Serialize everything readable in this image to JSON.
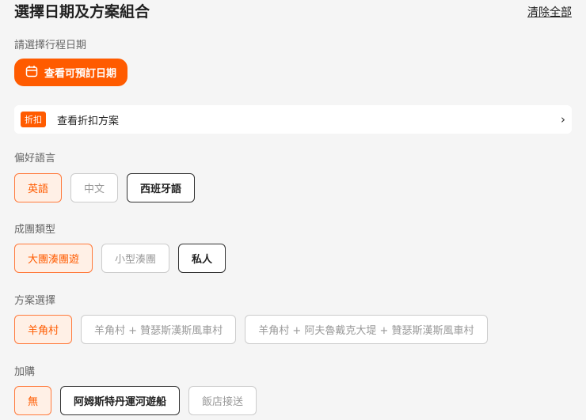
{
  "header": {
    "title": "選擇日期及方案組合",
    "clear_all": "清除全部"
  },
  "date": {
    "label": "請選擇行程日期",
    "button": "查看可預訂日期"
  },
  "discount": {
    "badge": "折扣",
    "text": "查看折扣方案"
  },
  "sections": [
    {
      "label": "偏好語言",
      "options": [
        {
          "text": "英語",
          "state": "selected"
        },
        {
          "text": "中文",
          "state": "disabled"
        },
        {
          "text": "西班牙語",
          "state": "available"
        }
      ]
    },
    {
      "label": "成團類型",
      "options": [
        {
          "text": "大團湊團遊",
          "state": "selected"
        },
        {
          "text": "小型湊團",
          "state": "disabled"
        },
        {
          "text": "私人",
          "state": "available"
        }
      ]
    },
    {
      "label": "方案選擇",
      "options": [
        {
          "text": "羊角村",
          "state": "selected"
        },
        {
          "text": "羊角村 + 贊瑟斯漢斯風車村",
          "state": "disabled"
        },
        {
          "text": "羊角村 + 阿夫魯戴克大堤 + 贊瑟斯漢斯風車村",
          "state": "disabled"
        }
      ]
    },
    {
      "label": "加購",
      "options": [
        {
          "text": "無",
          "state": "selected"
        },
        {
          "text": "阿姆斯特丹運河遊船",
          "state": "available"
        },
        {
          "text": "飯店接送",
          "state": "disabled"
        }
      ]
    }
  ]
}
